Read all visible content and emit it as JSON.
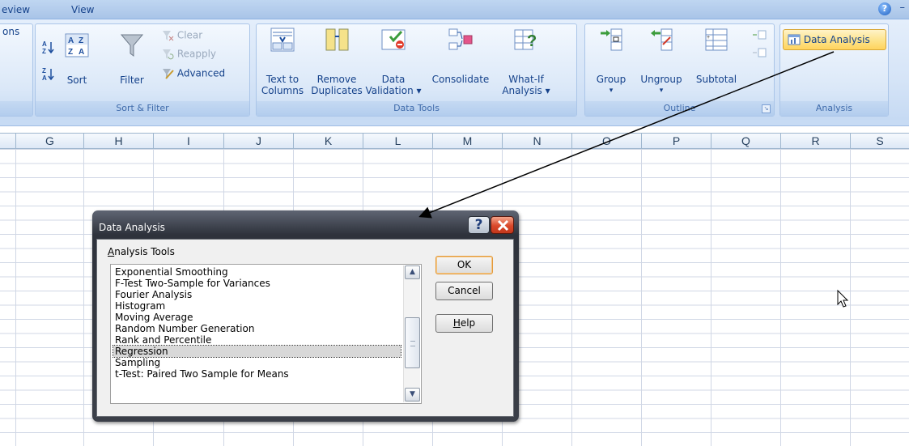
{
  "ribbon_tabs": {
    "review": "eview",
    "view": "View"
  },
  "left_cut_label": "ons",
  "sort_filter": {
    "sort_label": "Sort",
    "filter_label": "Filter",
    "clear_label": "Clear",
    "reapply_label": "Reapply",
    "advanced_label": "Advanced",
    "group_label": "Sort & Filter"
  },
  "data_tools": {
    "text_to_columns_line1": "Text to",
    "text_to_columns_line2": "Columns",
    "remove_duplicates_line1": "Remove",
    "remove_duplicates_line2": "Duplicates",
    "data_validation_line1": "Data",
    "data_validation_line2": "Validation",
    "consolidate_label": "Consolidate",
    "what_if_line1": "What-If",
    "what_if_line2": "Analysis",
    "group_label": "Data Tools"
  },
  "outline": {
    "group_button": "Group",
    "ungroup_button": "Ungroup",
    "subtotal_button": "Subtotal",
    "group_label": "Outline"
  },
  "analysis": {
    "data_analysis_button": "Data Analysis",
    "group_label": "Analysis"
  },
  "columns": [
    "G",
    "H",
    "I",
    "J",
    "K",
    "L",
    "M",
    "N",
    "O",
    "P",
    "Q",
    "R",
    "S"
  ],
  "dialog": {
    "title": "Data Analysis",
    "help_glyph": "?",
    "list_label_accel": "A",
    "list_label_rest": "nalysis Tools",
    "items": [
      "Exponential Smoothing",
      "F-Test Two-Sample for Variances",
      "Fourier Analysis",
      "Histogram",
      "Moving Average",
      "Random Number Generation",
      "Rank and Percentile",
      "Regression",
      "Sampling",
      "t-Test: Paired Two Sample for Means"
    ],
    "selected_item": "Regression",
    "ok_label": "OK",
    "cancel_label": "Cancel",
    "help_accel": "H",
    "help_rest": "elp"
  },
  "colors": {
    "ribbon_bg": "#d5e4f7",
    "ribbon_text": "#15428b",
    "dialog_frame": "#3b3f48",
    "close_red": "#d9482a",
    "highlight_button": "#fde38a"
  }
}
